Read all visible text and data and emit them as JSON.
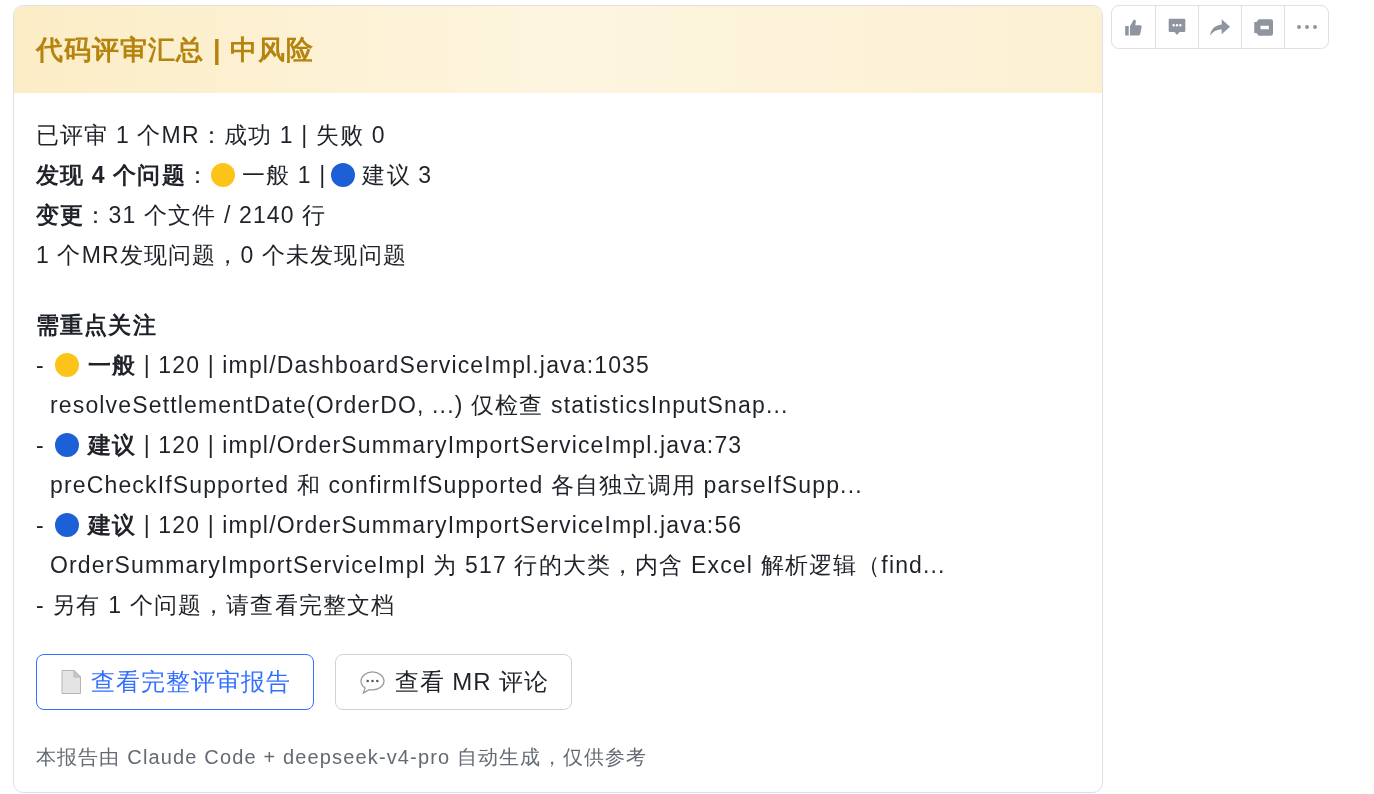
{
  "header": {
    "title": "代码评审汇总 | 中风险"
  },
  "summary": [
    {
      "kind": "text",
      "text": "已评审 1 个MR：成功 1 | 失败 0"
    },
    {
      "kind": "counts",
      "text": "**发现 4 个问题**：",
      "counts": [
        {
          "label": "一般 1 |",
          "color": "#fcc419"
        },
        {
          "label": "建议 3",
          "color": "#1c5fd6"
        }
      ]
    },
    {
      "kind": "text",
      "text": "**变更**：31 个文件 / 2140 行"
    },
    {
      "kind": "text",
      "text": "1 个MR发现问题，0 个未发现问题"
    }
  ],
  "focus": {
    "title": "需重点关注",
    "issues": [
      {
        "bullet": "-",
        "color": "#fcc419",
        "heading": "**一般** | 120 | impl/DashboardServiceImpl.java:1035",
        "detail": "resolveSettlementDate(OrderDO, ...) 仅检查 statisticsInputSnap..."
      },
      {
        "bullet": "-",
        "color": "#1c5fd6",
        "heading": "**建议** | 120 | impl/OrderSummaryImportServiceImpl.java:73",
        "detail": "preCheckIfSupported 和 confirmIfSupported 各自独立调用 parseIfSupp..."
      },
      {
        "bullet": "-",
        "color": "#1c5fd6",
        "heading": "**建议** | 120 | impl/OrderSummaryImportServiceImpl.java:56",
        "detail": "OrderSummaryImportServiceImpl 为 517 行的大类，内含 Excel 解析逻辑（find..."
      }
    ],
    "more": "- 另有 1 个问题，请查看完整文档"
  },
  "actions": [
    {
      "kind": "primary",
      "label": "查看完整评审报告"
    },
    {
      "kind": "secondary",
      "label": "查看 MR 评论"
    }
  ],
  "footer": "本报告由 Claude Code + deepseek-v4-pro 自动生成，仅供参考"
}
